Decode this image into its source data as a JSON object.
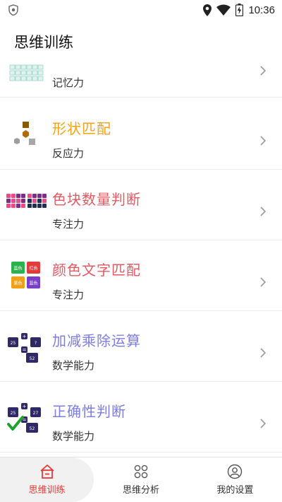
{
  "status_bar": {
    "time": "10:36"
  },
  "header": {
    "title": "思维训练"
  },
  "colors": {
    "accent": "#e53935",
    "orange": "#f0a21a",
    "red": "#e05a63",
    "purple": "#7d7de0",
    "chevron": "#9a9a9a"
  },
  "training_items": [
    {
      "name": "",
      "category": "记忆力",
      "icon": "memory-grid-icon"
    },
    {
      "name": "形状匹配",
      "category": "反应力",
      "icon": "shapes-icon"
    },
    {
      "name": "色块数量判断",
      "category": "专注力",
      "icon": "color-blocks-icon"
    },
    {
      "name": "颜色文字匹配",
      "category": "专注力",
      "icon": "color-words-icon",
      "icon_words": [
        "蓝色",
        "红色",
        "紫色",
        "蓝色"
      ]
    },
    {
      "name": "加减乘除运算",
      "category": "数学能力",
      "icon": "arithmetic-icon",
      "icon_numbers": [
        "25",
        "?",
        "52"
      ]
    },
    {
      "name": "正确性判断",
      "category": "数学能力",
      "icon": "check-math-icon",
      "icon_numbers": [
        "25",
        "27",
        "52"
      ]
    }
  ],
  "tabs": [
    {
      "label": "思维训练",
      "icon": "home-icon",
      "active": true
    },
    {
      "label": "思维分析",
      "icon": "four-dots-icon",
      "active": false
    },
    {
      "label": "我的设置",
      "icon": "user-icon",
      "active": false
    }
  ]
}
